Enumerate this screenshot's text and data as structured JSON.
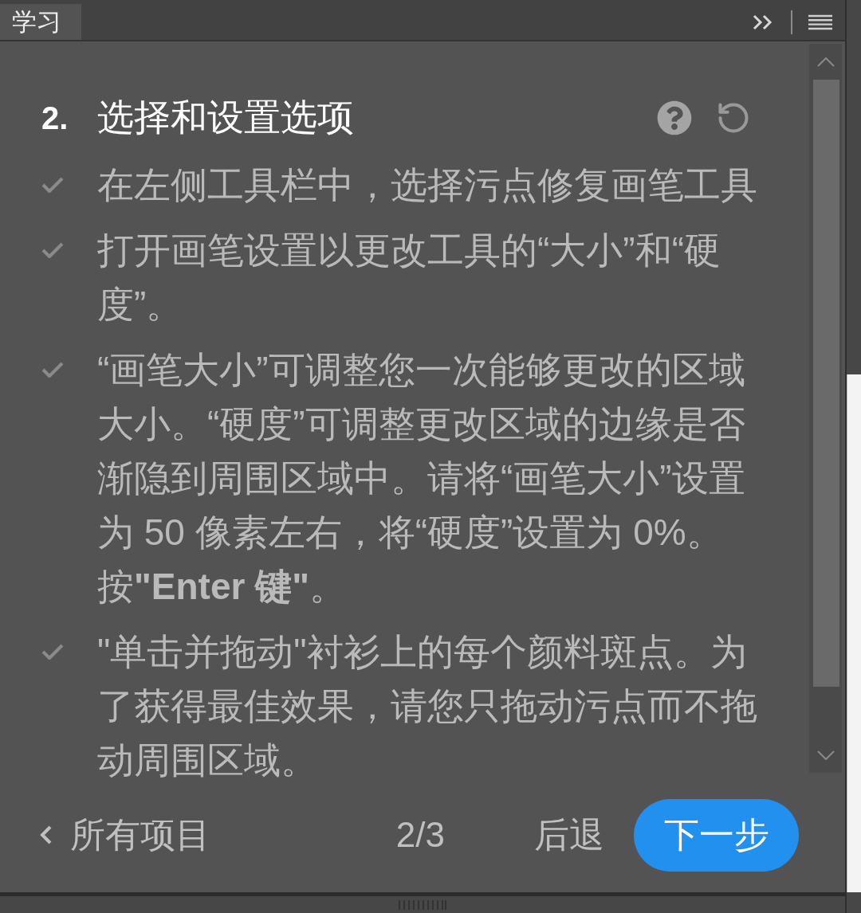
{
  "panel": {
    "tabs": [
      {
        "label": "学习",
        "selected": true
      }
    ]
  },
  "step": {
    "number": "2.",
    "title": "选择和设置选项"
  },
  "instructions": [
    "在左侧工具栏中，选择污点修复画笔工具",
    "打开画笔设置以更改工具的“大小”和“硬度”。",
    "“画笔大小”可调整您一次能够更改的区域大小。“硬度”可调整更改区域的边缘是否渐隐到周围区域中。请将“画笔大小”设置为 50 像素左右，将“硬度”设置为 0%。按**\"Enter 键\"**。",
    "\"单击并拖动\"衬衫上的每个颜料斑点。为了获得最佳效果，请您只拖动污点而不拖动周围区域。"
  ],
  "footer": {
    "all_projects": "所有项目",
    "page": "2/3",
    "back": "后退",
    "next": "下一步"
  }
}
